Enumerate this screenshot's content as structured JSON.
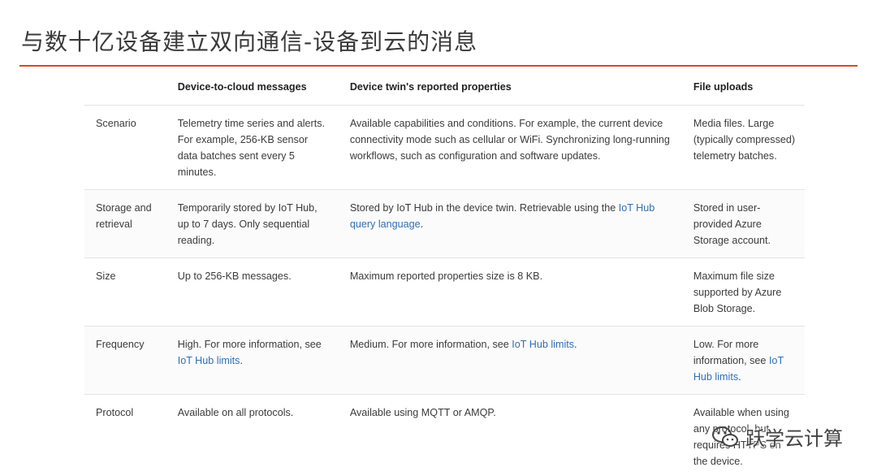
{
  "slide": {
    "title": "与数十亿设备建立双向通信-设备到云的消息"
  },
  "table": {
    "headers": [
      "",
      "Device-to-cloud messages",
      "Device twin's reported properties",
      "File uploads"
    ],
    "rows": [
      {
        "label": "Scenario",
        "d2c": "Telemetry time series and alerts. For example, 256-KB sensor data batches sent every 5 minutes.",
        "twin": "Available capabilities and conditions. For example, the current device connectivity mode such as cellular or WiFi. Synchronizing long-running workflows, such as configuration and software updates.",
        "file": "Media files. Large (typically compressed) telemetry batches."
      },
      {
        "label": "Storage and retrieval",
        "d2c": "Temporarily stored by IoT Hub, up to 7 days. Only sequential reading.",
        "twin_pre": "Stored by IoT Hub in the device twin. Retrievable using the ",
        "twin_link": "IoT Hub query language",
        "twin_post": ".",
        "file": "Stored in user-provided Azure Storage account."
      },
      {
        "label": "Size",
        "d2c": "Up to 256-KB messages.",
        "twin": "Maximum reported properties size is 8 KB.",
        "file": "Maximum file size supported by Azure Blob Storage."
      },
      {
        "label": "Frequency",
        "d2c_pre": "High. For more information, see ",
        "d2c_link": "IoT Hub limits",
        "d2c_post": ".",
        "twin_pre": "Medium. For more information, see ",
        "twin_link": "IoT Hub limits",
        "twin_post": ".",
        "file_pre": "Low. For more information, see ",
        "file_link": "IoT Hub limits",
        "file_post": "."
      },
      {
        "label": "Protocol",
        "d2c": "Available on all protocols.",
        "twin": "Available using MQTT or AMQP.",
        "file": "Available when using any protocol, but requires HTTPS on the device."
      }
    ]
  },
  "watermark": {
    "text": "跃学云计算",
    "icon": "wechat-icon"
  },
  "colors": {
    "accent_rule": "#d9472b",
    "link": "#2f6fb4"
  }
}
